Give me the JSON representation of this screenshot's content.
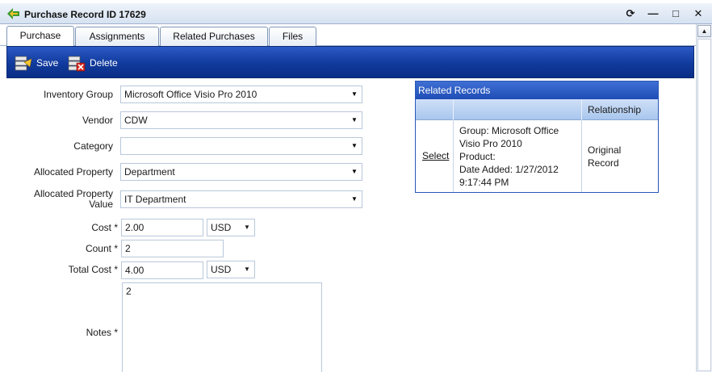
{
  "window": {
    "title": "Purchase Record ID 17629",
    "controls": {
      "refresh": "⟳",
      "minimize": "—",
      "maximize": "□",
      "close": "✕"
    }
  },
  "tabs": [
    {
      "label": "Purchase",
      "active": true
    },
    {
      "label": "Assignments",
      "active": false
    },
    {
      "label": "Related Purchases",
      "active": false
    },
    {
      "label": "Files",
      "active": false
    }
  ],
  "toolbar": {
    "save_label": "Save",
    "delete_label": "Delete"
  },
  "form": {
    "inventory_group": {
      "label": "Inventory Group",
      "value": "Microsoft Office Visio Pro 2010"
    },
    "vendor": {
      "label": "Vendor",
      "value": "CDW"
    },
    "category": {
      "label": "Category",
      "value": ""
    },
    "allocated_property": {
      "label": "Allocated Property",
      "value": "Department"
    },
    "allocated_property_value": {
      "label_line1": "Allocated Property",
      "label_line2": "Value",
      "value": "IT Department"
    },
    "cost": {
      "label": "Cost *",
      "value": "2.00",
      "currency": "USD"
    },
    "count": {
      "label": "Count *",
      "value": "2"
    },
    "total_cost": {
      "label": "Total Cost *",
      "value": "4.00",
      "currency": "USD"
    },
    "notes": {
      "label": "Notes *",
      "value": "2"
    }
  },
  "related_records": {
    "title": "Related Records",
    "columns": [
      "",
      "",
      "Relationship"
    ],
    "rows": [
      {
        "select_label": "Select",
        "details": [
          "Group: Microsoft Office",
          "Visio Pro 2010",
          "Product:",
          "Date Added: 1/27/2012",
          "9:17:44 PM"
        ],
        "relationship": [
          "Original",
          "Record"
        ]
      }
    ]
  },
  "colors": {
    "toolbar_blue": "#103a9c",
    "related_header_blue": "#1f4db6",
    "field_border": "#b9c8db"
  },
  "icons": {
    "title": "app-logo-icon",
    "save": "save-icon",
    "delete": "delete-icon"
  }
}
